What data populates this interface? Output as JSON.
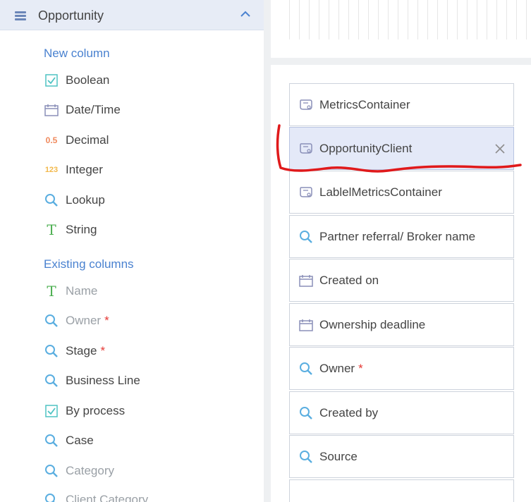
{
  "left_panel": {
    "group_title": "Opportunity",
    "new_columns_title": "New column",
    "new_columns": [
      {
        "label": "Boolean",
        "icon": "checkbox-icon"
      },
      {
        "label": "Date/Time",
        "icon": "calendar-icon"
      },
      {
        "label": "Decimal",
        "icon": "decimal-icon",
        "icon_text": "0.5"
      },
      {
        "label": "Integer",
        "icon": "integer-icon",
        "icon_text": "123"
      },
      {
        "label": "Lookup",
        "icon": "search-icon"
      },
      {
        "label": "String",
        "icon": "text-icon",
        "icon_text": "T"
      }
    ],
    "existing_columns_title": "Existing columns",
    "existing_columns": [
      {
        "label": "Name",
        "icon": "text-icon",
        "icon_text": "T",
        "disabled": true
      },
      {
        "label": "Owner",
        "icon": "search-icon",
        "required": "*",
        "disabled": true
      },
      {
        "label": "Stage",
        "icon": "search-icon",
        "required": "*"
      },
      {
        "label": "Business Line",
        "icon": "search-icon"
      },
      {
        "label": "By process",
        "icon": "checkbox-icon"
      },
      {
        "label": "Case",
        "icon": "search-icon"
      },
      {
        "label": "Category",
        "icon": "search-icon",
        "disabled": true
      },
      {
        "label": "Client Category",
        "icon": "search-icon",
        "disabled": true
      }
    ]
  },
  "fields": [
    {
      "label": "MetricsContainer",
      "icon": "container-icon"
    },
    {
      "label": "OpportunityClient",
      "icon": "container-icon",
      "selected": true
    },
    {
      "label": "LablelMetricsContainer",
      "icon": "container-icon"
    },
    {
      "label": "Partner referral/ Broker name",
      "icon": "search-icon"
    },
    {
      "label": "Created on",
      "icon": "calendar-icon"
    },
    {
      "label": "Ownership deadline",
      "icon": "calendar-icon"
    },
    {
      "label": "Owner",
      "icon": "search-icon",
      "required": "*"
    },
    {
      "label": "Created by",
      "icon": "search-icon"
    },
    {
      "label": "Source",
      "icon": "search-icon"
    }
  ],
  "colors": {
    "accent": "#4a82d0",
    "search_icon": "#5aaee0",
    "text_icon": "#4caf50",
    "decimal_icon": "#f08a5d",
    "integer_icon": "#f2b84b",
    "checkbox_icon": "#4fc3c3",
    "required": "#e53935",
    "annotation": "#e0191b"
  }
}
